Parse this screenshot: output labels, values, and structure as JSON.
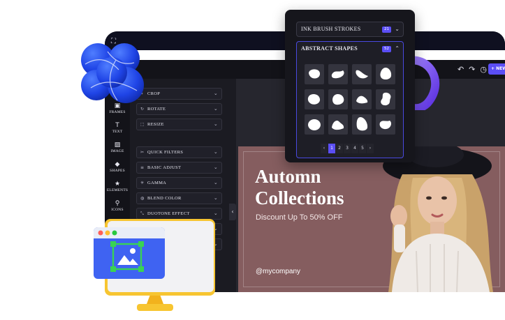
{
  "topbar": {
    "corner_icon": "fullscreen-icon",
    "undo_icon": "↶",
    "redo_icon": "↷",
    "history_icon": "◷",
    "new_button": "+ NEW"
  },
  "rail": [
    {
      "icon": "frames-icon",
      "glyph": "▣",
      "label": "FRAMES"
    },
    {
      "icon": "text-icon",
      "glyph": "T",
      "label": "TEXT"
    },
    {
      "icon": "image-icon",
      "glyph": "▨",
      "label": "IMAGE"
    },
    {
      "icon": "shapes-icon",
      "glyph": "◆",
      "label": "SHAPES"
    },
    {
      "icon": "elements-icon",
      "glyph": "★",
      "label": "ELEMENTS"
    },
    {
      "icon": "icons-icon",
      "glyph": "⚲",
      "label": "ICONS"
    }
  ],
  "tools": [
    {
      "icon": "crop-icon",
      "glyph": "⌗",
      "label": "CROP"
    },
    {
      "icon": "rotate-icon",
      "glyph": "↻",
      "label": "ROTATE"
    },
    {
      "icon": "resize-icon",
      "glyph": "⬚",
      "label": "RESIZE"
    },
    {
      "icon": "filters-icon",
      "glyph": "✂",
      "label": "QUICK FILTERS"
    },
    {
      "icon": "adjust-icon",
      "glyph": "≡",
      "label": "BASIC ADJUST"
    },
    {
      "icon": "gamma-icon",
      "glyph": "✳",
      "label": "GAMMA"
    },
    {
      "icon": "blend-icon",
      "glyph": "◍",
      "label": "BLEND COLOR"
    },
    {
      "icon": "duotone-icon",
      "glyph": "⤡",
      "label": "DUOTONE EFFECT"
    }
  ],
  "shapes_popup": {
    "sections": [
      {
        "label": "INK BRUSH STROKES",
        "count": "21",
        "expanded": false
      },
      {
        "label": "ABSTRACT SHAPES",
        "count": "52",
        "expanded": true
      }
    ],
    "pagination": {
      "prev": "‹",
      "pages": [
        "1",
        "2",
        "3",
        "4",
        "5"
      ],
      "current": "1",
      "next": "›"
    }
  },
  "design": {
    "title_line1": "Automn",
    "title_line2": "Collections",
    "subtitle": "Discount Up To 50% OFF",
    "handle": "@mycompany"
  },
  "colors": {
    "accent": "#5b4ef5",
    "panel_bg": "#1b1b22",
    "design_bg": "#855d5f"
  }
}
